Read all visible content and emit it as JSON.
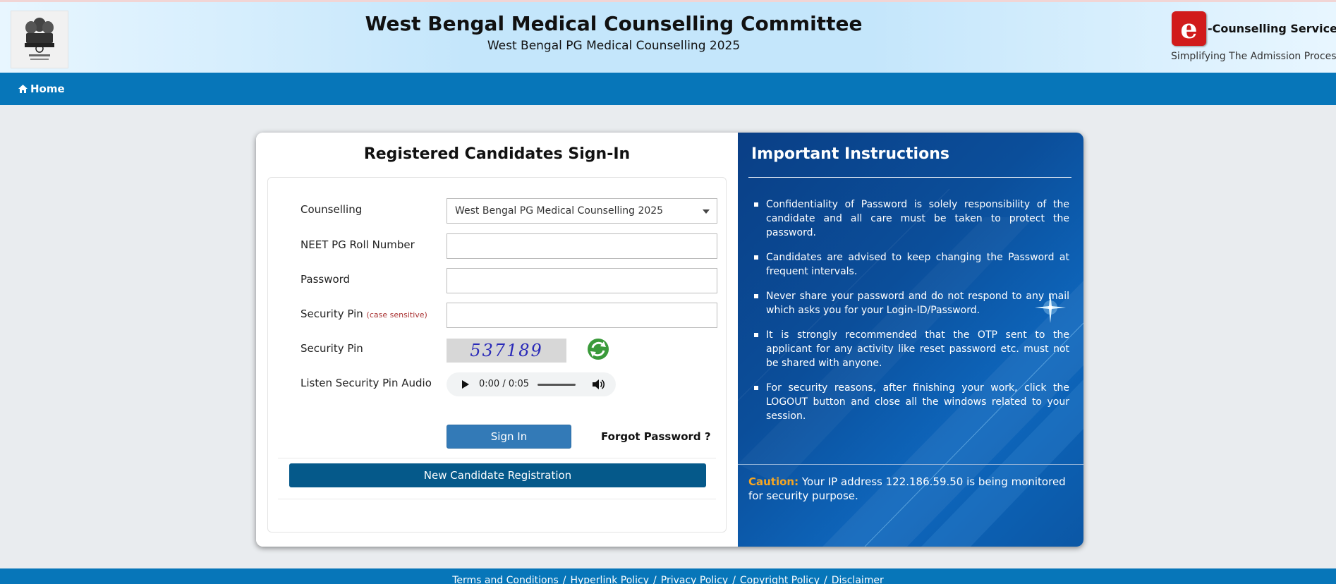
{
  "header": {
    "title": "West Bengal Medical Counselling Committee",
    "subtitle": "West Bengal PG Medical Counselling 2025",
    "brand_name": "-Counselling Services",
    "brand_tagline": "Simplifying The Admission Process",
    "brand_logo_letter": "e"
  },
  "nav": {
    "home_label": "Home"
  },
  "signin": {
    "title": "Registered Candidates Sign-In",
    "counselling_label": "Counselling",
    "counselling_value": "West Bengal PG Medical Counselling 2025",
    "roll_label": "NEET PG Roll Number",
    "roll_value": "",
    "password_label": "Password",
    "password_value": "",
    "pin_label": "Security Pin",
    "pin_note": "(case sensitive)",
    "pin_value": "",
    "pin_image_label": "Security Pin",
    "captcha_text": "537189",
    "audio_label": "Listen Security Pin Audio",
    "audio_time": "0:00 / 0:05",
    "signin_button": "Sign In",
    "forgot_link": "Forgot Password ?",
    "new_registration_button": "New Candidate Registration"
  },
  "instructions": {
    "title": "Important Instructions",
    "items": [
      "Confidentiality of Password is solely responsibility of the candidate and all care must be taken to protect the password.",
      "Candidates are advised to keep changing the Password at frequent intervals.",
      "Never share your password and do not respond to any mail which asks you for your Login-ID/Password.",
      "It is strongly recommended that the OTP sent to the applicant for any activity like reset password etc. must not be shared with anyone.",
      "For security reasons, after finishing your work, click the LOGOUT button and close all the windows related to your session."
    ],
    "caution_label": "Caution:",
    "caution_text": "Your IP address 122.186.59.50 is being monitored for security purpose."
  },
  "footer": {
    "links": [
      "Terms and Conditions",
      "Hyperlink Policy",
      "Privacy Policy",
      "Copyright Policy",
      "Disclaimer"
    ],
    "separator": "/"
  },
  "colors": {
    "nav_blue": "#0776b9",
    "signin_button": "#337ab7",
    "registration_button": "#05598a",
    "caution_accent": "#f5a623",
    "brand_red": "#d11b1b"
  },
  "icons": [
    "state-emblem-icon",
    "home-icon",
    "refresh-captcha-icon",
    "play-icon",
    "volume-icon",
    "dropdown-caret-icon"
  ]
}
